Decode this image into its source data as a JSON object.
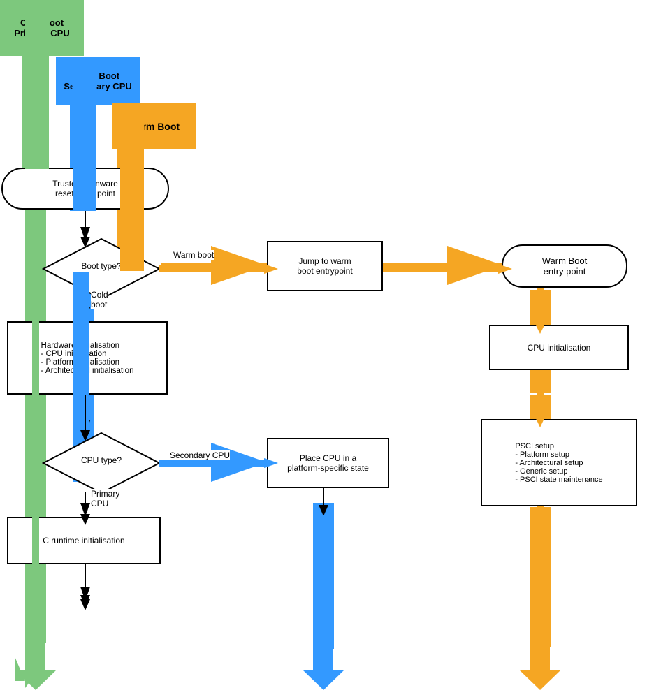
{
  "labels": {
    "cold_boot_primary": "Cold Boot\nPrimary CPU",
    "cold_boot_secondary": "Cold Boot\nSecondary CPU",
    "warm_boot": "Warm Boot",
    "tf_reset": "Trusted Firmware\nreset entry point",
    "boot_type": "Boot type?",
    "warm_boot_label": "Warm boot",
    "cold_boot_flow": "Cold\nboot",
    "jump_to_warm": "Jump to warm\nboot entrypoint",
    "warm_boot_entry": "Warm Boot\nentry point",
    "hw_init": "Hardware initialisation\n  - CPU initialisation\n - Platform initialisation\n- Architectural initialisation",
    "cpu_type": "CPU type?",
    "secondary_cpu": "Secondary CPU",
    "primary_cpu": "Primary\nCPU",
    "place_cpu": "Place CPU in a\nplatform-specific state",
    "c_runtime": "C runtime initialisation",
    "cpu_init": "CPU initialisation",
    "psci_setup": "PSCI setup\n- Platform setup\n- Architectural setup\n- Generic setup\n- PSCI state maintenance"
  },
  "colors": {
    "green": "#7dc87d",
    "blue": "#3399ff",
    "orange": "#f5a623",
    "black": "#000000",
    "white": "#ffffff"
  }
}
